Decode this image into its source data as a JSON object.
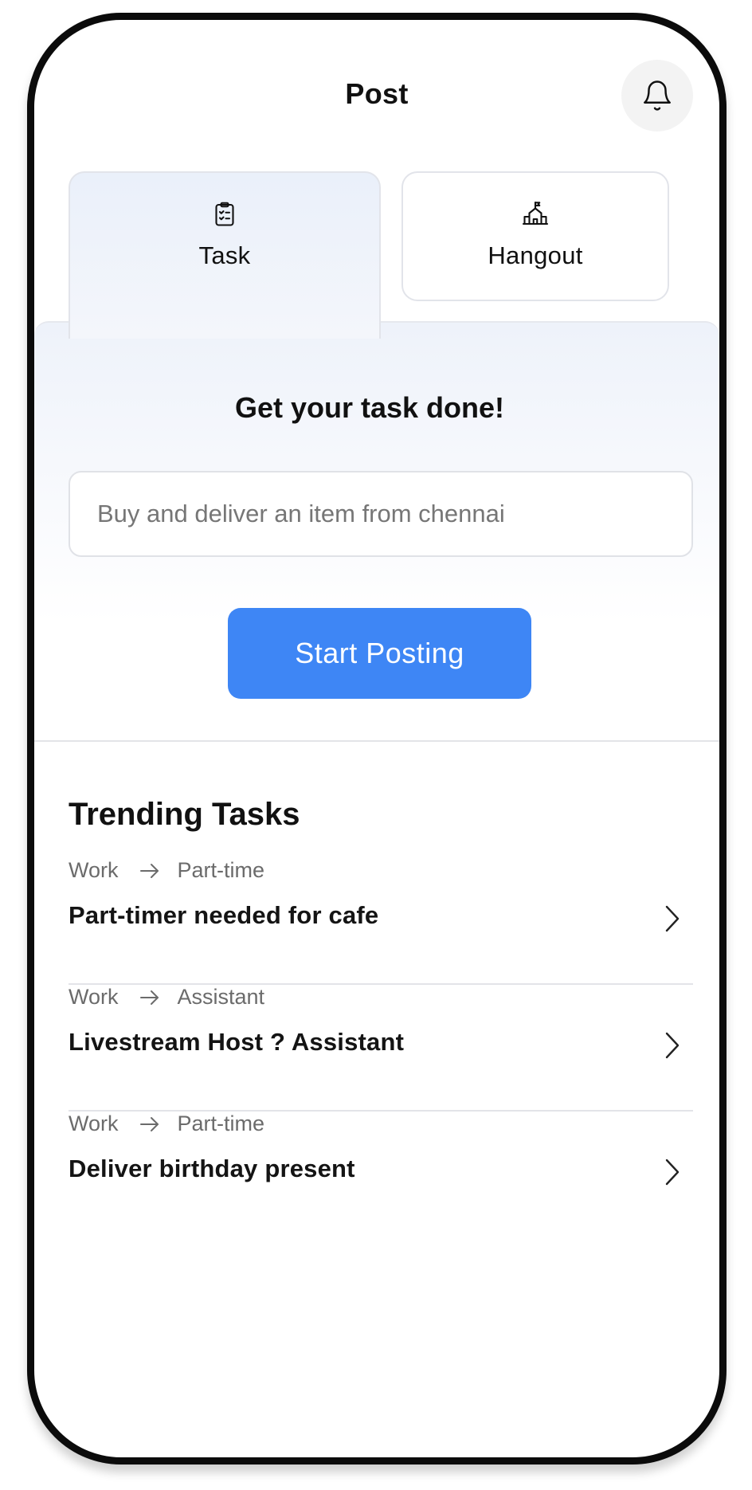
{
  "header": {
    "title": "Post",
    "bell_icon": "bell-icon"
  },
  "tabs": [
    {
      "label": "Task",
      "icon": "clipboard-checklist-icon",
      "active": true
    },
    {
      "label": "Hangout",
      "icon": "building-flag-icon",
      "active": false
    }
  ],
  "hero": {
    "title": "Get your task done!",
    "input_placeholder": "Buy and deliver an item from chennai",
    "input_value": "",
    "button_label": "Start Posting"
  },
  "trending": {
    "title": "Trending Tasks",
    "items": [
      {
        "category": "Work",
        "subcategory": "Part-time",
        "title": "Part-timer needed for cafe"
      },
      {
        "category": "Work",
        "subcategory": "Assistant",
        "title": "Livestream Host ? Assistant"
      },
      {
        "category": "Work",
        "subcategory": "Part-time",
        "title": "Deliver birthday present"
      }
    ]
  },
  "colors": {
    "accent": "#3e86f5",
    "text_primary": "#111111",
    "text_secondary": "#6b6b6b",
    "border": "#e3e4e8"
  }
}
